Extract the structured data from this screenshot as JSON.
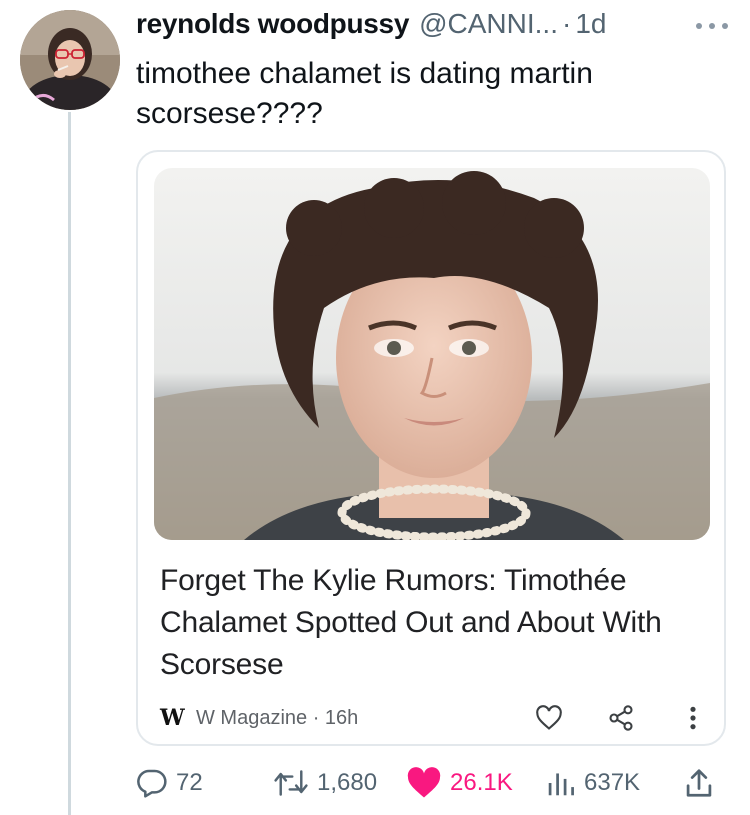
{
  "tweet": {
    "display_name": "reynolds woodpussy",
    "handle": "@CANNI...",
    "separator": "·",
    "time": "1d",
    "text": "timothee chalamet is dating martin scorsese????"
  },
  "card": {
    "title": "Forget The Kylie Rumors: Timothée Chalamet Spotted Out and About With Scorsese",
    "logo_letter": "W",
    "source": "W Magazine · 16h"
  },
  "actions": {
    "replies": "72",
    "retweets": "1,680",
    "likes": "26.1K",
    "views": "637K"
  },
  "colors": {
    "like_accent": "#f91880",
    "muted": "#536471",
    "thread_line": "#cfd9de"
  },
  "icons": [
    "reply-icon",
    "retweet-icon",
    "heart-icon",
    "views-icon",
    "share-icon",
    "more-icon"
  ]
}
